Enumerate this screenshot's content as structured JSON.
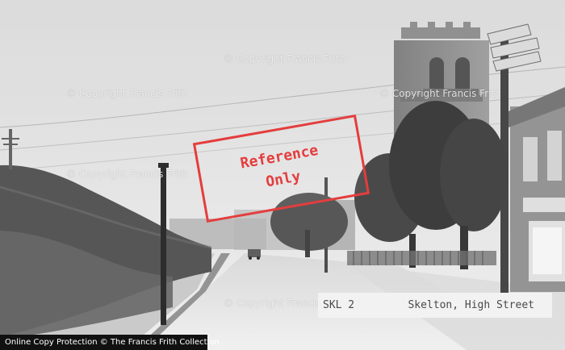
{
  "image": {
    "alt_text": "Skelton, High Street"
  },
  "watermarks": [
    "© Copyright Francis Frith",
    "© Copyright Francis Frith",
    "© Copyright Francis Frith",
    "© Copyright Francis Frith",
    "© Copyright Francis Frith"
  ],
  "stamp": {
    "line1": "Reference",
    "line2": "Only"
  },
  "caption": {
    "code": "SKL 2",
    "title": "Skelton, High Street"
  },
  "footer": {
    "link_text": "Online Copy Protection © The Francis Frith Collection"
  },
  "colors": {
    "stamp_red": "#e43d3d",
    "footer_bg": "#111111",
    "caption_bg": "#f2f2f2"
  }
}
